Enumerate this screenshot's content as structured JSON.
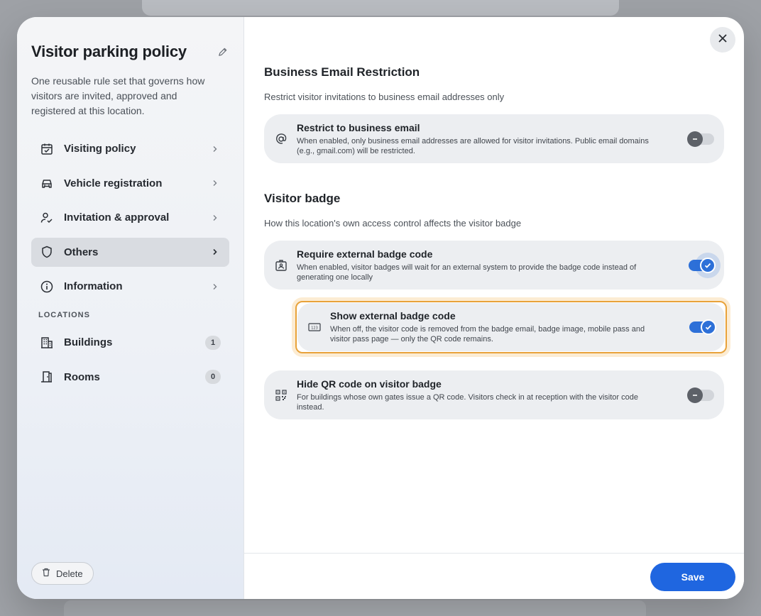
{
  "sidebar": {
    "title": "Visitor parking policy",
    "description": "One reusable rule set that governs how visitors are invited, approved and registered at this location.",
    "nav": [
      {
        "label": "Visiting policy",
        "icon": "calendar-check-icon"
      },
      {
        "label": "Vehicle registration",
        "icon": "car-icon"
      },
      {
        "label": "Invitation & approval",
        "icon": "user-check-icon"
      },
      {
        "label": "Others",
        "icon": "shield-icon",
        "active": true
      },
      {
        "label": "Information",
        "icon": "info-icon"
      }
    ],
    "locations_label": "LOCATIONS",
    "locations": [
      {
        "label": "Buildings",
        "count": "1",
        "icon": "building-icon"
      },
      {
        "label": "Rooms",
        "count": "0",
        "icon": "door-icon"
      }
    ],
    "delete_label": "Delete"
  },
  "main": {
    "sections": [
      {
        "title": "Business Email Restriction",
        "subtitle": "Restrict visitor invitations to business email addresses only",
        "cards": [
          {
            "title": "Restrict to business email",
            "description": "When enabled, only business email addresses are allowed for visitor invitations. Public email domains (e.g., gmail.com) will be restricted.",
            "icon": "at-sign-icon",
            "enabled": false
          }
        ]
      },
      {
        "title": "Visitor badge",
        "subtitle": "How this location's own access control affects the visitor badge",
        "cards": [
          {
            "title": "Require external badge code",
            "description": "When enabled, visitor badges will wait for an external system to provide the badge code instead of generating one locally",
            "icon": "id-badge-icon",
            "enabled": true
          },
          {
            "title": "Show external badge code",
            "description": "When off, the visitor code is removed from the badge email, badge image, mobile pass and visitor pass page — only the QR code remains.",
            "icon": "number-code-icon",
            "enabled": true,
            "highlighted": true
          },
          {
            "title": "Hide QR code on visitor badge",
            "description": "For buildings whose own gates issue a QR code. Visitors check in at reception with the visitor code instead.",
            "icon": "qr-code-icon",
            "enabled": false
          }
        ]
      }
    ],
    "save_label": "Save"
  },
  "colors": {
    "accent": "#1f66e0",
    "highlight_border": "#e8a23a",
    "card_bg": "#eceef1"
  }
}
